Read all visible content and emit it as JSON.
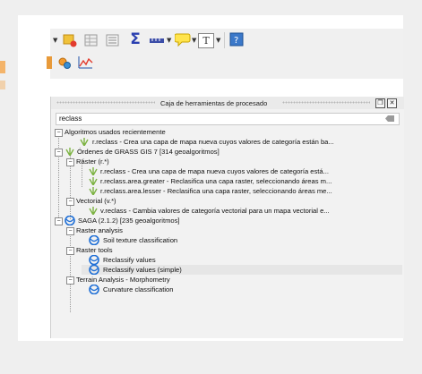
{
  "panel": {
    "title": "Caja de herramientas de procesado",
    "float_btn": "❐",
    "close_btn": "✕"
  },
  "search": {
    "value": "reclass"
  },
  "tree": {
    "recent": "Algoritmos usados recientemente",
    "recent_item": "r.reclass - Crea una capa de mapa nueva cuyos valores de categoría están ba...",
    "grass": "Órdenes de GRASS GIS 7 [314 geoalgoritmos]",
    "raster": "Ráster (r.*)",
    "r1": "r.reclass - Crea una capa de mapa nueva cuyos valores de categoría está...",
    "r2": "r.reclass.area.greater - Reclasifica una capa raster, seleccionando áreas m...",
    "r3": "r.reclass.area.lesser - Reclasifica una capa raster, seleccionando áreas me...",
    "vector": "Vectorial (v.*)",
    "v1": "v.reclass - Cambia valores de categoría vectorial para un mapa vectorial e...",
    "saga": "SAGA (2.1.2) [235 geoalgoritmos]",
    "ra": "Raster analysis",
    "ra1": "Soil texture classification",
    "rt": "Raster tools",
    "rt1": "Reclassify values",
    "rt2": "Reclassify values (simple)",
    "ta": "Terrain Analysis - Morphometry",
    "ta1": "Curvature classification"
  },
  "toolbar": {
    "sigma": "Σ",
    "text_tool": "T"
  },
  "colors": {
    "green_arrow": "#7cb342",
    "saga_blue": "#1f6fd6",
    "highlight": "#e6e6e6"
  }
}
